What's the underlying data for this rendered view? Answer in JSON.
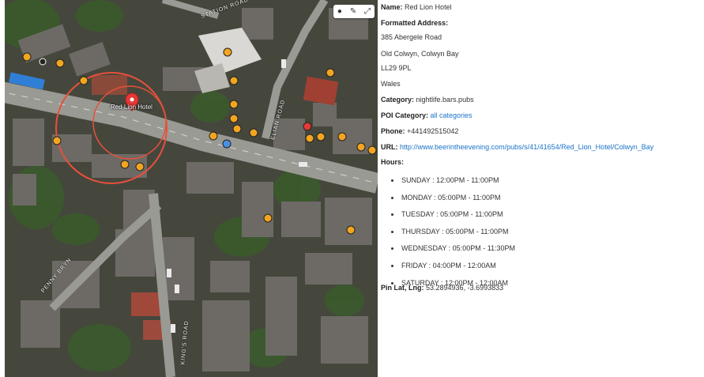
{
  "map": {
    "poi_label": "Red Lion Hotel",
    "streets": [
      "STATION ROAD",
      "ELIAN ROAD",
      "PENNY BRYN",
      "KING'S ROAD"
    ],
    "controls": [
      "pin-icon",
      "pencil-icon",
      "expand-icon"
    ],
    "colors": {
      "circle": "#e8503a",
      "pin": "#e53935",
      "poi_marker": "#f2a51f"
    }
  },
  "info": {
    "name_label": "Name:",
    "name_value": "Red Lion Hotel",
    "address_label": "Formatted Address:",
    "address_lines": [
      "385 Abergele Road",
      "Old Colwyn, Colwyn Bay",
      "LL29 9PL",
      "Wales"
    ],
    "category_label": "Category:",
    "category_value": "nightlife.bars.pubs",
    "poi_category_label": "POI Category:",
    "poi_category_link": "all categories",
    "phone_label": "Phone:",
    "phone_value": "+441492515042",
    "url_label": "URL:",
    "url_value": "http://www.beerintheevening.com/pubs/s/41/41654/Red_Lion_Hotel/Colwyn_Bay",
    "hours_label": "Hours:",
    "hours": [
      "SUNDAY : 12:00PM - 11:00PM",
      "MONDAY : 05:00PM - 11:00PM",
      "TUESDAY : 05:00PM - 11:00PM",
      "THURSDAY : 05:00PM - 11:00PM",
      "WEDNESDAY : 05:00PM - 11:30PM",
      "FRIDAY : 04:00PM - 12:00AM",
      "SATURDAY : 12:00PM - 12:00AM"
    ],
    "pin_label": "Pin Lat, Lng:",
    "pin_value": "53.2894936, -3.6993833"
  }
}
